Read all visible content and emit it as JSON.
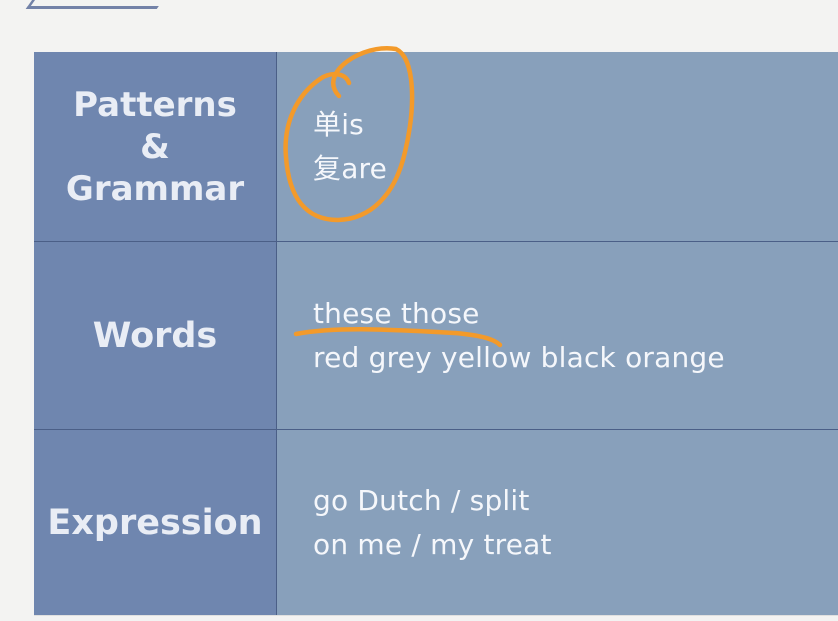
{
  "table": {
    "rows": [
      {
        "category": "Patterns\n&\nGrammar",
        "items": [
          "单is",
          "复are"
        ]
      },
      {
        "category": "Words",
        "items": [
          "these those",
          "red grey yellow black orange"
        ]
      },
      {
        "category": "Expression",
        "items": [
          "go Dutch / split",
          "on me / my treat"
        ]
      }
    ]
  },
  "colors": {
    "left_column": "#6f86af",
    "right_column": "#88a0bb",
    "annotation": "#f39a2a",
    "text": "#f5f7fb"
  },
  "annotations": {
    "circle_icon": "orange-ink-circle",
    "underline_icon": "orange-ink-underline"
  }
}
